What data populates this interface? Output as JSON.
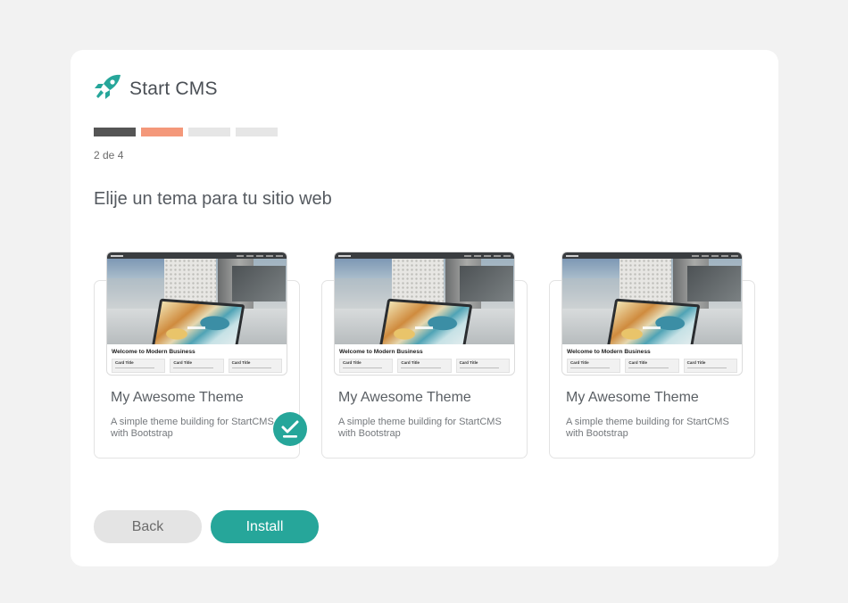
{
  "brand": {
    "name": "Start CMS",
    "logo_icon": "rocket-icon",
    "accent_color": "#26a69a"
  },
  "progress": {
    "current_step": 2,
    "total_steps": 4,
    "label": "2 de 4",
    "colors": {
      "done": "#555555",
      "current": "#f4987a",
      "pending": "#e6e6e6"
    }
  },
  "heading": "Elije un tema para tu sitio web",
  "themes": [
    {
      "name": "My Awesome Theme",
      "description": "A simple theme building for StartCMS with Bootstrap",
      "selected": true,
      "preview": {
        "brand": "Start CMS",
        "welcome": "Welcome to Modern Business",
        "cards": [
          "Card Title",
          "Card Title",
          "Card Title"
        ]
      }
    },
    {
      "name": "My Awesome Theme",
      "description": "A simple theme building for StartCMS with Bootstrap",
      "selected": false,
      "preview": {
        "brand": "Start CMS",
        "welcome": "Welcome to Modern Business",
        "cards": [
          "Card Title",
          "Card Title",
          "Card Title"
        ]
      }
    },
    {
      "name": "My Awesome Theme",
      "description": "A simple theme building for StartCMS with Bootstrap",
      "selected": false,
      "preview": {
        "brand": "Start CMS",
        "welcome": "Welcome to Modern Business",
        "cards": [
          "Card Title",
          "Card Title",
          "Card Title"
        ]
      }
    }
  ],
  "selected_icon": "check-circle-icon",
  "buttons": {
    "back": "Back",
    "install": "Install"
  }
}
